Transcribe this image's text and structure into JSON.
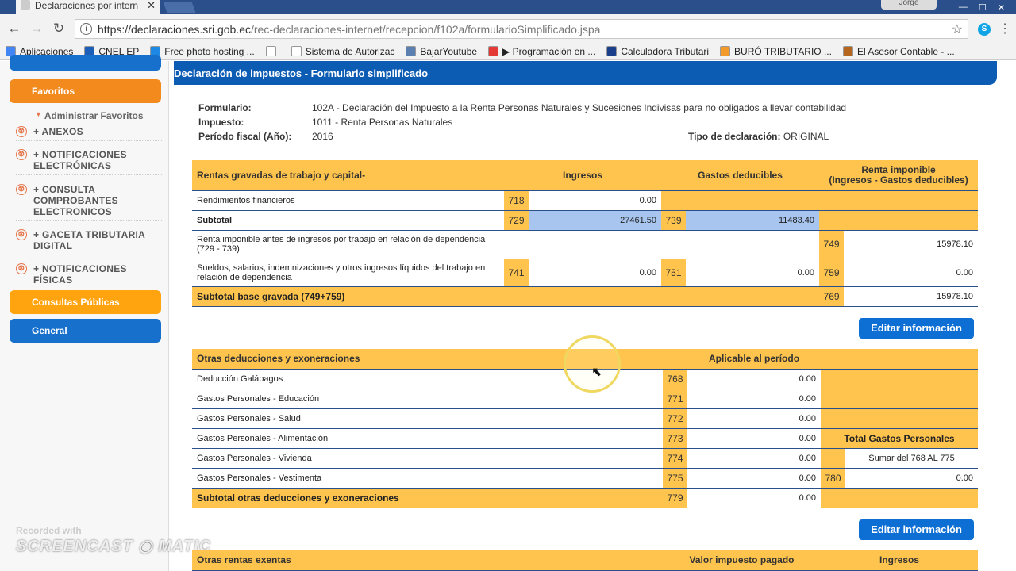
{
  "browser": {
    "tab_title": "Declaraciones por intern",
    "url_prefix": "https://declaraciones.sri.gob.ec",
    "url_path": "/rec-declaraciones-internet/recepcion/f102a/formularioSimplificado.jspa",
    "user": "Jorge"
  },
  "bookmarks": [
    {
      "label": "Aplicaciones",
      "color": "#4285f4"
    },
    {
      "label": "CNEL EP",
      "color": "#1b5fb8"
    },
    {
      "label": "Free photo hosting ...",
      "color": "#1e88e5"
    },
    {
      "label": "",
      "color": "#ffffff"
    },
    {
      "label": "Sistema de Autorizac",
      "color": "#ffffff"
    },
    {
      "label": "BajarYoutube",
      "color": "#5a7fb0"
    },
    {
      "label": "▶ Programación en ...",
      "color": "#e53935"
    },
    {
      "label": "Calculadora Tributari",
      "color": "#1b3f8a"
    },
    {
      "label": "BURÓ TRIBUTARIO ...",
      "color": "#f39a2b"
    },
    {
      "label": "El Asesor Contable - ...",
      "color": "#b5651d"
    }
  ],
  "sidebar": {
    "favoritos": "Favoritos",
    "administrar": "Administrar Favoritos",
    "items": [
      "+ ANEXOS",
      "+ NOTIFICACIONES ELECTRÓNICAS",
      "+ CONSULTA COMPROBANTES ELECTRONICOS",
      "+ GACETA TRIBUTARIA DIGITAL",
      "+ NOTIFICACIONES FÍSICAS"
    ],
    "consultas": "Consultas Públicas",
    "general": "General"
  },
  "watermark": {
    "recorded": "Recorded with",
    "brand": "SCREENCAST ◉ MATIC"
  },
  "header": {
    "title": "Declaración de impuestos - Formulario simplificado"
  },
  "info": {
    "formulario_label": "Formulario:",
    "formulario_value": "102A - Declaración del Impuesto a la Renta Personas Naturales y Sucesiones Indivisas para no obligados a llevar contabilidad",
    "impuesto_label": "Impuesto:",
    "impuesto_value": "1011 - Renta Personas Naturales",
    "periodo_label": "Período fiscal (Año):",
    "periodo_value": "2016",
    "tipo_label": "Tipo de declaración:",
    "tipo_value": "ORIGINAL"
  },
  "table1": {
    "header": [
      "Rentas gravadas de trabajo y capital-",
      "Ingresos",
      "Gastos deducibles",
      "Renta imponible\n(Ingresos - Gastos deducibles)"
    ],
    "rend_label": "Rendimientos financieros",
    "rend_code": "718",
    "rend_val": "0.00",
    "subtotal_label": "Subtotal",
    "sub_c1": "729",
    "sub_v1": "27461.50",
    "sub_c2": "739",
    "sub_v2": "11483.40",
    "renta_label": "Renta imponible antes de ingresos por trabajo en relación de dependencia\n(729 - 739)",
    "renta_code": "749",
    "renta_val": "15978.10",
    "sueldos_label": "Sueldos, salarios, indemnizaciones y otros ingresos líquidos del trabajo en\nrelación de dependencia",
    "s_c1": "741",
    "s_v1": "0.00",
    "s_c2": "751",
    "s_v2": "0.00",
    "s_c3": "759",
    "s_v3": "0.00",
    "base_label": "Subtotal base gravada (749+759)",
    "base_code": "769",
    "base_val": "15978.10"
  },
  "edit_button": "Editar información",
  "table2": {
    "header_left": "Otras deducciones y exoneraciones",
    "header_right": "Aplicable al período",
    "rows": [
      {
        "label": "Deducción Galápagos",
        "code": "768",
        "value": "0.00"
      },
      {
        "label": "Gastos Personales - Educación",
        "code": "771",
        "value": "0.00"
      },
      {
        "label": "Gastos Personales - Salud",
        "code": "772",
        "value": "0.00"
      },
      {
        "label": "Gastos Personales - Alimentación",
        "code": "773",
        "value": "0.00"
      },
      {
        "label": "Gastos Personales - Vivienda",
        "code": "774",
        "value": "0.00"
      },
      {
        "label": "Gastos Personales - Vestimenta",
        "code": "775",
        "value": "0.00"
      }
    ],
    "total_gp": "Total Gastos Personales",
    "sumar": "Sumar del 768 AL 775",
    "total_code": "780",
    "total_val": "0.00",
    "subtotal_label": "Subtotal otras deducciones y exoneraciones",
    "subtotal_code": "779",
    "subtotal_val": "0.00"
  },
  "table3": {
    "c1": "Otras rentas exentas",
    "c2": "Valor impuesto pagado",
    "c3": "Ingresos"
  }
}
